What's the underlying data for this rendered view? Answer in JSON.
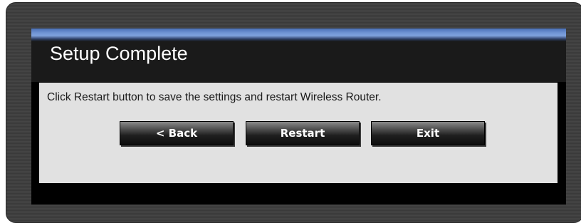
{
  "dialog": {
    "title": "Setup Complete",
    "message": "Click Restart button to save the settings and restart Wireless Router."
  },
  "buttons": {
    "back_label": "< Back",
    "restart_label": "Restart",
    "exit_label": "Exit"
  },
  "colors": {
    "frame_background": "#3c3c3c",
    "title_accent": "#6f93d3",
    "content_background": "#e1e1e1",
    "button_text": "#ffffff"
  }
}
